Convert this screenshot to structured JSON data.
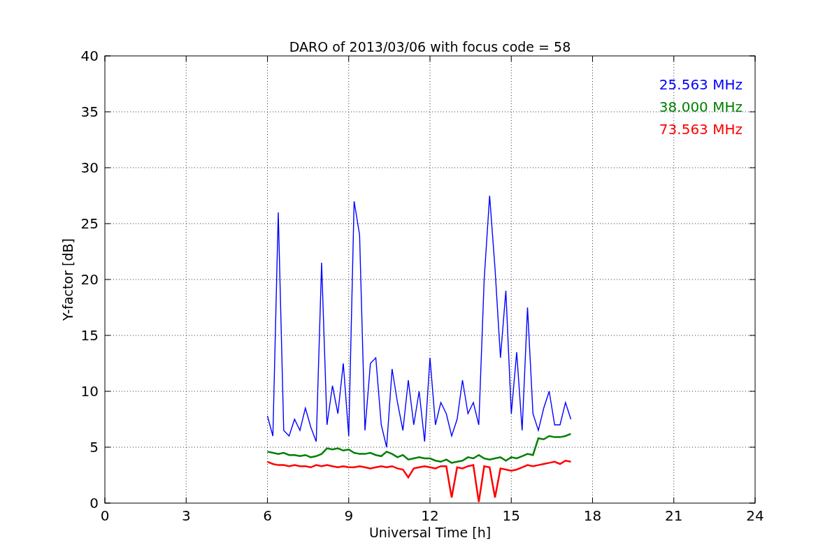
{
  "figure": {
    "chart_data": {
      "type": "line",
      "title": "DARO of 2013/03/06 with focus code = 58",
      "xlabel": "Universal Time [h]",
      "ylabel": "Y-factor [dB]",
      "x": [
        6.0,
        6.2,
        6.4,
        6.6,
        6.8,
        7.0,
        7.2,
        7.4,
        7.6,
        7.8,
        8.0,
        8.2,
        8.4,
        8.6,
        8.8,
        9.0,
        9.2,
        9.4,
        9.6,
        9.8,
        10.0,
        10.2,
        10.4,
        10.6,
        10.8,
        11.0,
        11.2,
        11.4,
        11.6,
        11.8,
        12.0,
        12.2,
        12.4,
        12.6,
        12.8,
        13.0,
        13.2,
        13.4,
        13.6,
        13.8,
        14.0,
        14.2,
        14.4,
        14.6,
        14.8,
        15.0,
        15.2,
        15.4,
        15.6,
        15.8,
        16.0,
        16.2,
        16.4,
        16.6,
        16.8,
        17.0,
        17.2
      ],
      "series": [
        {
          "name": "25.563 MHz",
          "color": "#0000ff",
          "values": [
            7.8,
            6.0,
            26,
            6.5,
            6.0,
            7.5,
            6.5,
            8.5,
            6.8,
            5.5,
            21.5,
            7.0,
            10.5,
            8.0,
            12.5,
            6.0,
            27,
            24,
            6.5,
            12.5,
            13,
            7,
            5,
            12,
            9,
            6.5,
            11,
            7,
            10,
            5.5,
            13,
            7,
            9,
            8,
            6,
            7.5,
            11,
            8,
            9,
            7,
            20,
            27.5,
            21,
            13,
            19,
            8,
            13.5,
            6.5,
            17.5,
            8,
            6.5,
            8.5,
            10,
            7,
            7,
            9,
            7.5
          ]
        },
        {
          "name": "38.000 MHz",
          "color": "#008000",
          "values": [
            4.6,
            4.5,
            4.4,
            4.5,
            4.3,
            4.3,
            4.2,
            4.3,
            4.1,
            4.2,
            4.4,
            4.9,
            4.8,
            4.9,
            4.7,
            4.8,
            4.5,
            4.4,
            4.4,
            4.5,
            4.3,
            4.2,
            4.6,
            4.4,
            4.1,
            4.3,
            3.9,
            4.0,
            4.1,
            4.0,
            4.0,
            3.8,
            3.7,
            3.9,
            3.6,
            3.7,
            3.8,
            4.1,
            4.0,
            4.3,
            4.0,
            3.9,
            4.0,
            4.1,
            3.8,
            4.1,
            4.0,
            4.2,
            4.4,
            4.3,
            5.8,
            5.7,
            6.0,
            5.9,
            5.9,
            6.0,
            6.2
          ]
        },
        {
          "name": "73.563 MHz",
          "color": "#ff0000",
          "values": [
            3.7,
            3.5,
            3.4,
            3.4,
            3.3,
            3.4,
            3.3,
            3.3,
            3.2,
            3.4,
            3.3,
            3.4,
            3.3,
            3.2,
            3.3,
            3.2,
            3.2,
            3.3,
            3.2,
            3.1,
            3.2,
            3.3,
            3.2,
            3.3,
            3.1,
            3.0,
            2.3,
            3.1,
            3.2,
            3.3,
            3.2,
            3.1,
            3.3,
            3.3,
            0.5,
            3.2,
            3.1,
            3.3,
            3.4,
            0.1,
            3.3,
            3.2,
            0.5,
            3.1,
            3.0,
            2.9,
            3.0,
            3.2,
            3.4,
            3.3,
            3.4,
            3.5,
            3.6,
            3.7,
            3.5,
            3.8,
            3.7
          ]
        }
      ],
      "grid": true,
      "xlim": [
        0,
        24
      ],
      "ylim": [
        0,
        40
      ],
      "xticks": [
        0,
        3,
        6,
        9,
        12,
        15,
        18,
        21,
        24
      ],
      "yticks": [
        0,
        5,
        10,
        15,
        20,
        25,
        30,
        35,
        40
      ]
    }
  }
}
